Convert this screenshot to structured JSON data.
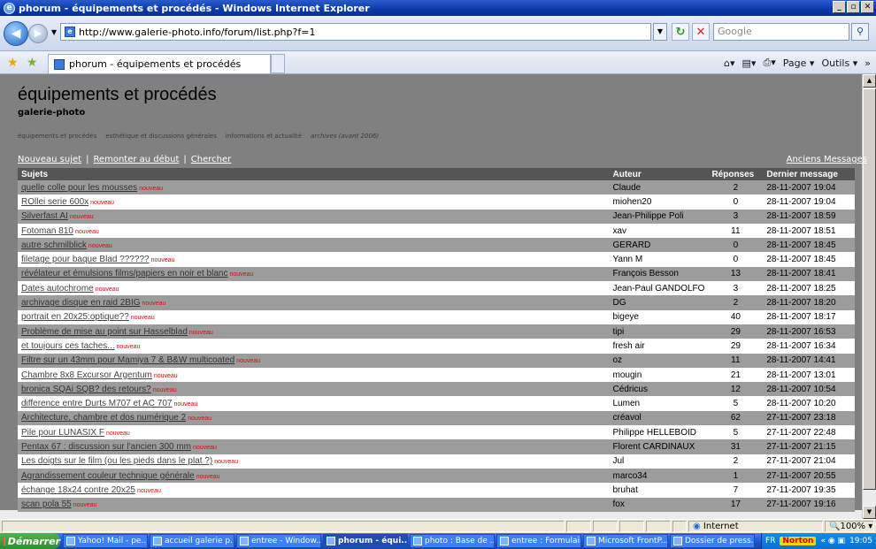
{
  "window": {
    "title": "phorum - équipements et procédés - Windows Internet Explorer"
  },
  "browser": {
    "url": "http://www.galerie-photo.info/forum/list.php?f=1",
    "search_placeholder": "Google",
    "tab_title": "phorum - équipements et procédés",
    "cmd_page": "Page",
    "cmd_outils": "Outils"
  },
  "page": {
    "title": "équipements et procédés",
    "subtitle": "galerie-photo",
    "subnav": [
      "équipements et procédés",
      "esthétique et discussions générales",
      "informations et actualité",
      "archives (avant 2006)"
    ],
    "tools": {
      "new": "Nouveau sujet",
      "top": "Remonter au début",
      "search": "Chercher",
      "sep": "|",
      "old": "Anciens Messages"
    },
    "headers": {
      "subject": "Sujets",
      "author": "Auteur",
      "replies": "Réponses",
      "last": "Dernier message"
    },
    "new_tag": "nouveau",
    "rows": [
      {
        "s": "quelle colle pour les mousses",
        "a": "Claude",
        "r": "2",
        "d": "28-11-2007 19:04",
        "n": true
      },
      {
        "s": "ROllei serie 600x",
        "a": "miohen20",
        "r": "0",
        "d": "28-11-2007 19:04",
        "n": true
      },
      {
        "s": "Silverfast AI",
        "a": "Jean-Philippe Poli",
        "r": "3",
        "d": "28-11-2007 18:59",
        "n": true
      },
      {
        "s": "Fotoman 810",
        "a": "xav",
        "r": "11",
        "d": "28-11-2007 18:51",
        "n": true
      },
      {
        "s": "autre schmilblick",
        "a": "GERARD",
        "r": "0",
        "d": "28-11-2007 18:45",
        "n": true
      },
      {
        "s": "filetage pour baque Blad ??????",
        "a": "Yann M",
        "r": "0",
        "d": "28-11-2007 18:45",
        "n": true
      },
      {
        "s": "révélateur et émulsions films/papiers en noir et blanc",
        "a": "François Besson",
        "r": "13",
        "d": "28-11-2007 18:41",
        "n": true
      },
      {
        "s": "Dates autochrome",
        "a": "Jean-Paul GANDOLFO",
        "r": "3",
        "d": "28-11-2007 18:25",
        "n": true
      },
      {
        "s": "archivage disque en raid 2BIG",
        "a": "DG",
        "r": "2",
        "d": "28-11-2007 18:20",
        "n": true
      },
      {
        "s": "portrait en 20x25:optique??",
        "a": "bigeye",
        "r": "40",
        "d": "28-11-2007 18:17",
        "n": true
      },
      {
        "s": "Problème de mise au point sur Hasselblad",
        "a": "tipi",
        "r": "29",
        "d": "28-11-2007 16:53",
        "n": true
      },
      {
        "s": "et toujours ces taches...",
        "a": "fresh air",
        "r": "29",
        "d": "28-11-2007 16:34",
        "n": true
      },
      {
        "s": "Filtre sur un 43mm pour Mamiya 7 & B&W multicoated",
        "a": "oz",
        "r": "11",
        "d": "28-11-2007 14:41",
        "n": true
      },
      {
        "s": "Chambre 8x8 Excursor Argentum",
        "a": "mougin",
        "r": "21",
        "d": "28-11-2007 13:01",
        "n": true
      },
      {
        "s": "bronica SQAi SQB? des retours?",
        "a": "Cédricus",
        "r": "12",
        "d": "28-11-2007 10:54",
        "n": true
      },
      {
        "s": "difference entre Durts M707 et AC 707",
        "a": "Lumen",
        "r": "5",
        "d": "28-11-2007 10:20",
        "n": true
      },
      {
        "s": "Architecture, chambre et dos numérique 2",
        "a": "créavol",
        "r": "62",
        "d": "27-11-2007 23:18",
        "n": true,
        "b": true
      },
      {
        "s": "Pile pour LUNASIX F",
        "a": "Philippe HELLEBOID",
        "r": "5",
        "d": "27-11-2007 22:48",
        "n": true
      },
      {
        "s": "Pentax 67 : discussion sur l'ancien 300 mm",
        "a": "Florent CARDINAUX",
        "r": "31",
        "d": "27-11-2007 21:15",
        "n": true
      },
      {
        "s": "Les doigts sur le film (ou les pieds dans le plat ?)",
        "a": "Jul",
        "r": "2",
        "d": "27-11-2007 21:04",
        "n": true
      },
      {
        "s": "Agrandissement couleur technique générale",
        "a": "marco34",
        "r": "1",
        "d": "27-11-2007 20:55",
        "n": true
      },
      {
        "s": "échange 18x24 contre 20x25",
        "a": "bruhat",
        "r": "7",
        "d": "27-11-2007 19:35",
        "n": true
      },
      {
        "s": "scan pola 55",
        "a": "fox",
        "r": "17",
        "d": "27-11-2007 19:16",
        "n": true
      }
    ]
  },
  "status": {
    "zone": "Internet",
    "zoom": "100%"
  },
  "taskbar": {
    "start": "Démarrer",
    "items": [
      "Yahoo! Mail - pe...",
      "accueil galerie p...",
      "entree - Window...",
      "phorum - équi...",
      "photo : Base de ...",
      "entree : Formulaire",
      "Microsoft FrontP...",
      "Dossier de press..."
    ],
    "lang": "FR",
    "norton": "Norton",
    "time": "19:05"
  }
}
